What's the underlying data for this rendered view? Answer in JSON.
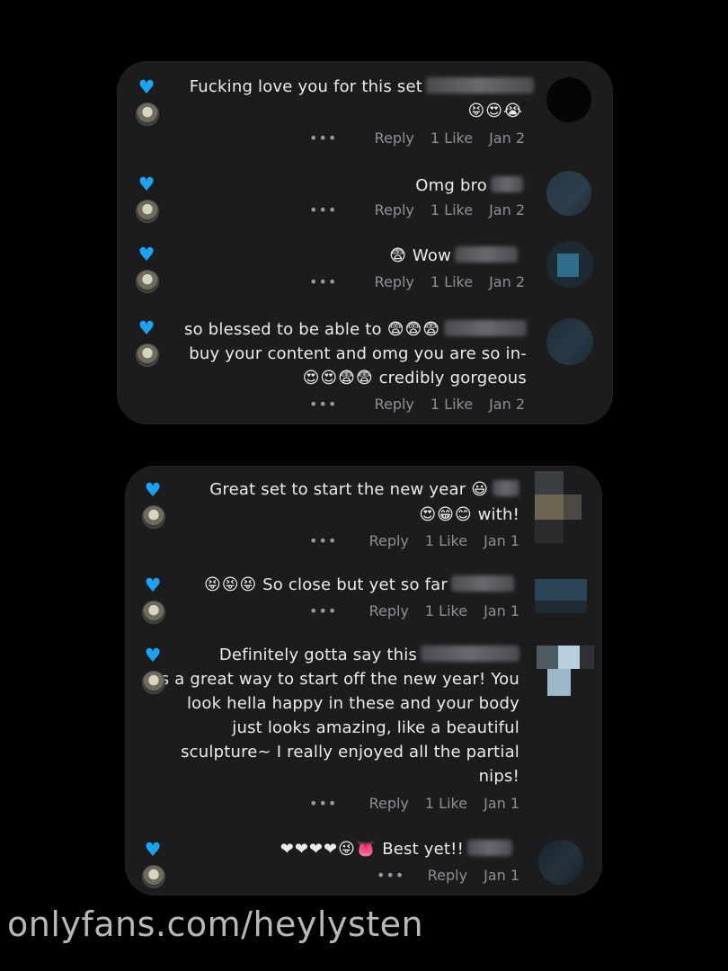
{
  "cards": [
    {
      "comments": [
        {
          "lines": [
            "Fucking love you for this set"
          ],
          "emoji_line": "😝😍😭",
          "date": "Jan 2",
          "likes": "1 Like",
          "reply": "Reply",
          "more": "•••"
        },
        {
          "lines": [
            "Omg bro"
          ],
          "emoji_line": "",
          "date": "Jan 2",
          "likes": "1 Like",
          "reply": "Reply",
          "more": "•••"
        },
        {
          "lines": [
            "Wow"
          ],
          "emoji_line": "😨",
          "date": "Jan 2",
          "likes": "1 Like",
          "reply": "Reply",
          "more": "•••"
        },
        {
          "lines": [
            "so blessed to be able to",
            "buy your content and omg you are so in-",
            "credibly gorgeous"
          ],
          "emoji_line": "😍😍😨😨",
          "date": "Jan 2",
          "likes": "1 Like",
          "reply": "Reply",
          "more": "•••"
        }
      ]
    },
    {
      "comments": [
        {
          "lines": [
            "Great set to start the new year",
            "with!"
          ],
          "emoji_line": "😍😁😊",
          "date": "Jan 1",
          "likes": "1 Like",
          "reply": "Reply",
          "more": "•••"
        },
        {
          "lines": [
            "So close but yet so far"
          ],
          "emoji_line": "😝😝😝",
          "date": "Jan 1",
          "likes": "1 Like",
          "reply": "Reply",
          "more": "•••"
        },
        {
          "lines": [
            "Definitely gotta say this",
            "is a great way to start off the new year! You",
            "look hella happy in these and your body",
            "just looks amazing, like a beautiful",
            "sculpture~ I really enjoyed all the partial",
            "nips!"
          ],
          "emoji_line": "",
          "date": "Jan 1",
          "likes": "1 Like",
          "reply": "Reply",
          "more": "•••"
        },
        {
          "lines": [
            "Best yet!!"
          ],
          "emoji_line": "❤❤❤❤😜👅",
          "date": "Jan 1",
          "likes": "",
          "reply": "Reply",
          "more": "•••"
        }
      ]
    }
  ],
  "icons": {
    "like": "heart-icon",
    "avatar": "avatar-icon",
    "more": "more-dots-icon"
  },
  "colors": {
    "heart": "#1da1f2",
    "card": "#1c1c1e",
    "background": "#000000"
  },
  "watermark": "onlyfans.com/heylysten"
}
